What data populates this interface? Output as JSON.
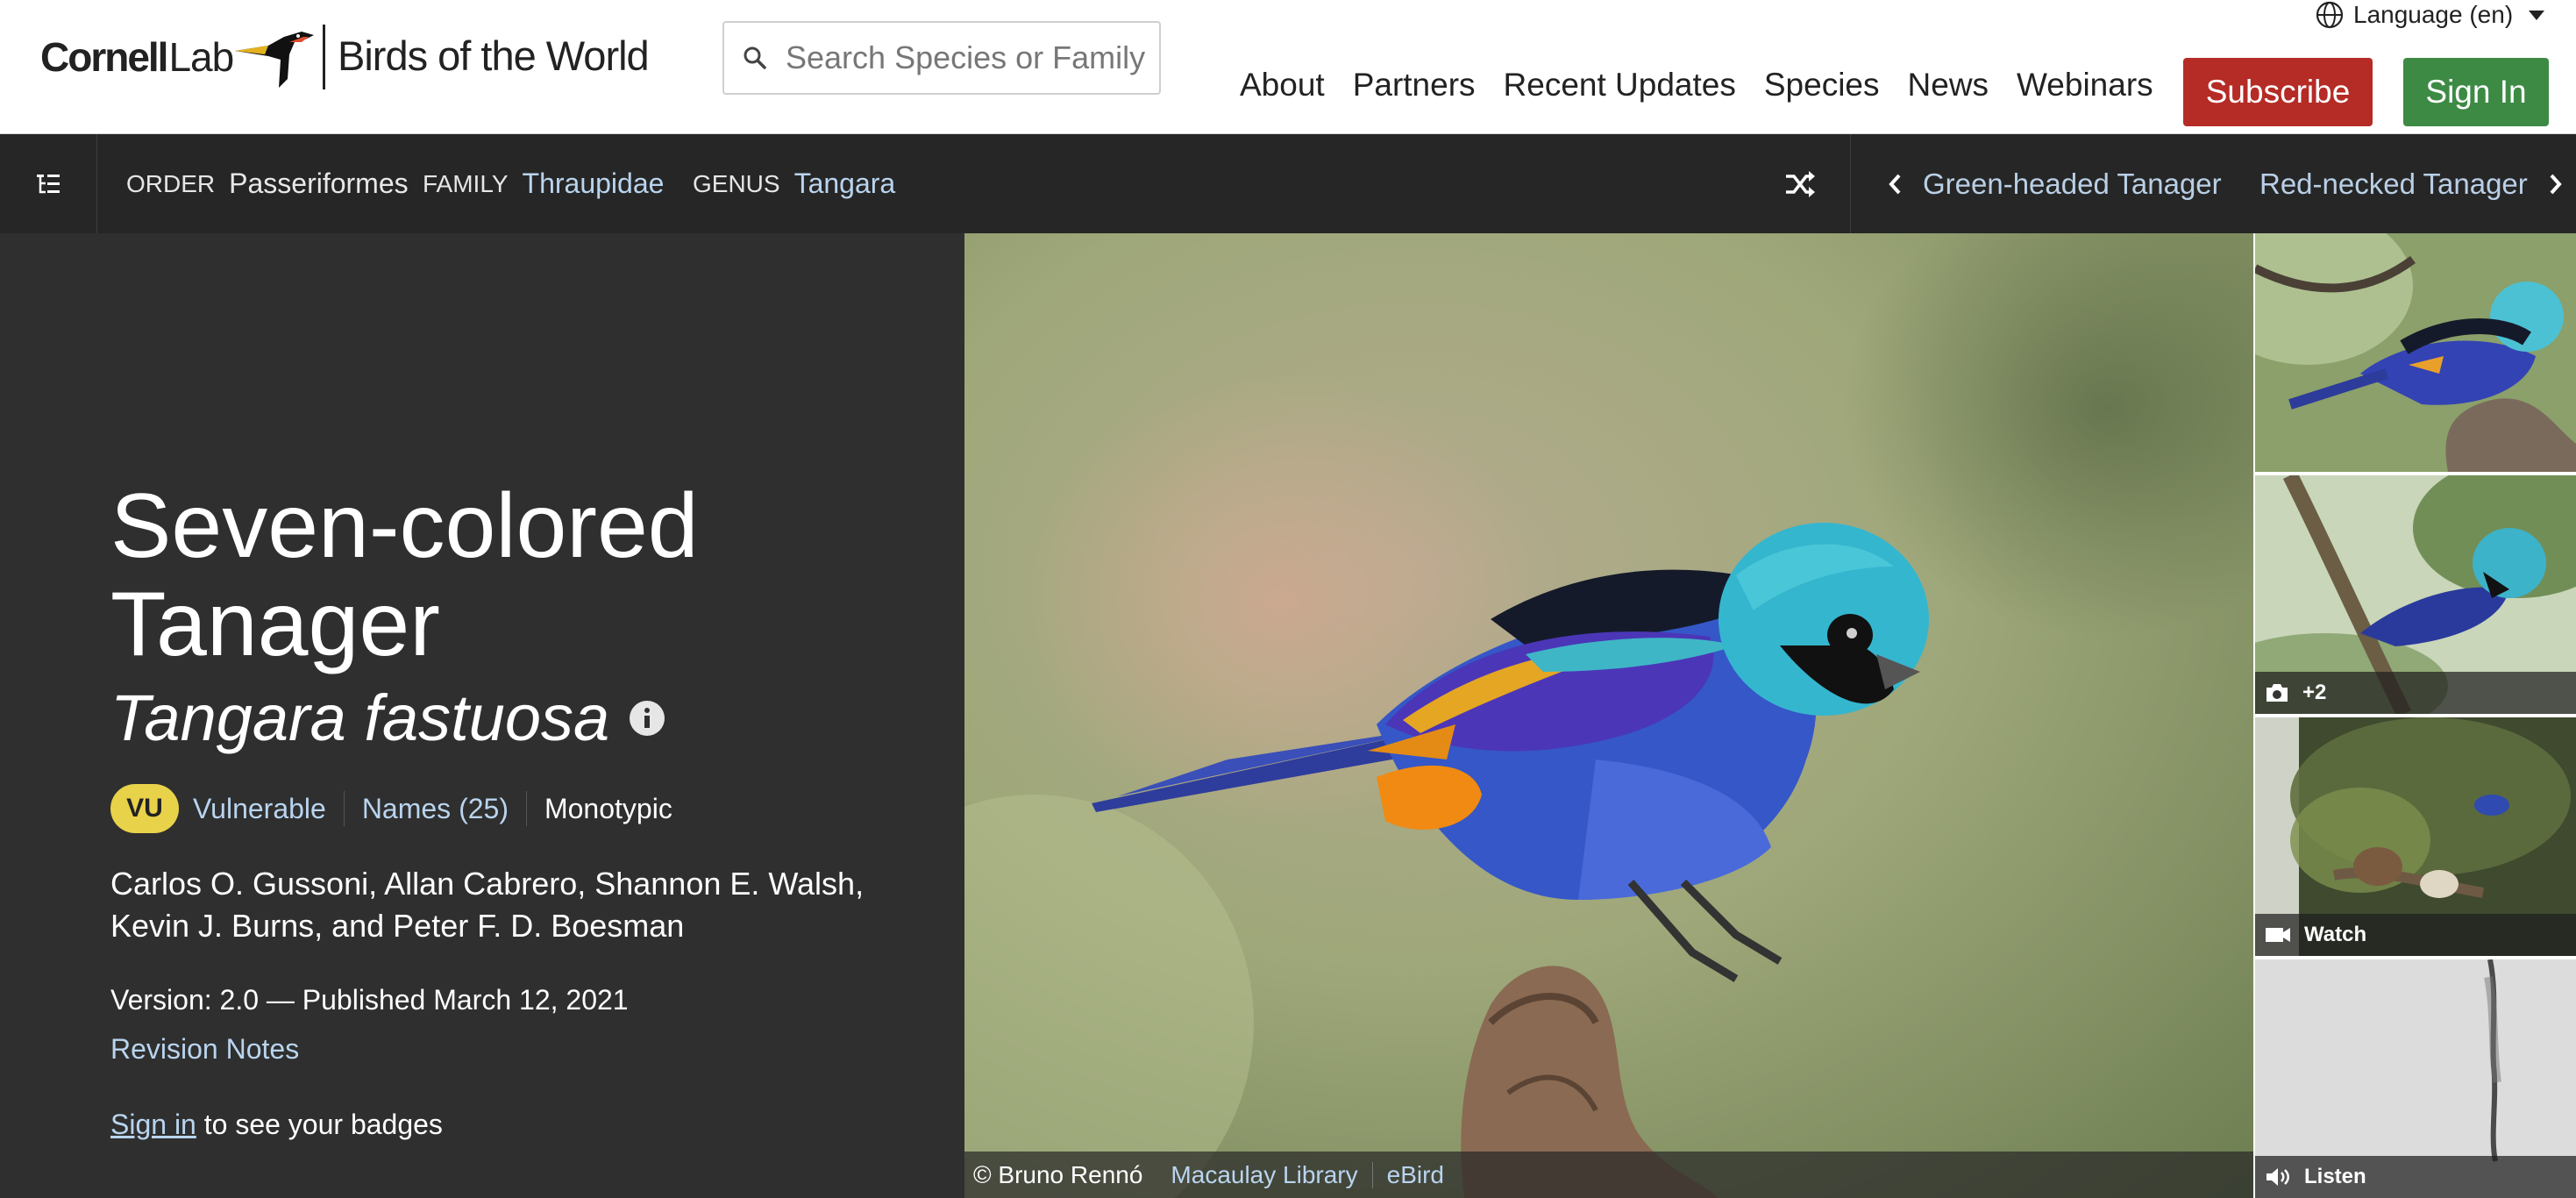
{
  "header": {
    "logo_cornell": "Cornell",
    "logo_lab": "Lab",
    "logo_botw": "Birds of the World",
    "search_placeholder": "Search Species or Family",
    "language": "Language (en)",
    "nav": [
      "About",
      "Partners",
      "Recent Updates",
      "Species",
      "News",
      "Webinars"
    ],
    "subscribe": "Subscribe",
    "sign_in": "Sign In"
  },
  "taxonomy": {
    "order_label": "ORDER",
    "order": "Passeriformes",
    "family_label": "FAMILY",
    "family": "Thraupidae",
    "genus_label": "GENUS",
    "genus": "Tangara",
    "prev_species": "Green-headed Tanager",
    "next_species": "Red-necked Tanager"
  },
  "species": {
    "common_name": "Seven-colored Tanager",
    "scientific_name": "Tangara fastuosa",
    "status_code": "VU",
    "status": "Vulnerable",
    "names": "Names (25)",
    "taxonomy_note": "Monotypic",
    "authors": "Carlos O. Gussoni, Allan Cabrero, Shannon E. Walsh, Kevin J. Burns, and Peter F. D. Boesman",
    "version": "Version: 2.0 — Published March 12, 2021",
    "revision_notes": "Revision Notes",
    "badges_link": "Sign in",
    "badges_text": " to see your badges"
  },
  "photo": {
    "credit": "© Bruno Rennó",
    "library": "Macaulay Library",
    "ebird": "eBird"
  },
  "thumbs": {
    "photos_more": "+2",
    "watch": "Watch",
    "listen": "Listen"
  },
  "colors": {
    "subscribe": "#b52b26",
    "sign_in": "#3d8a45",
    "taxbar": "#262626",
    "panel": "#2f2f2f",
    "link": "#b9d4ee",
    "vu_badge": "#e8d24a"
  }
}
